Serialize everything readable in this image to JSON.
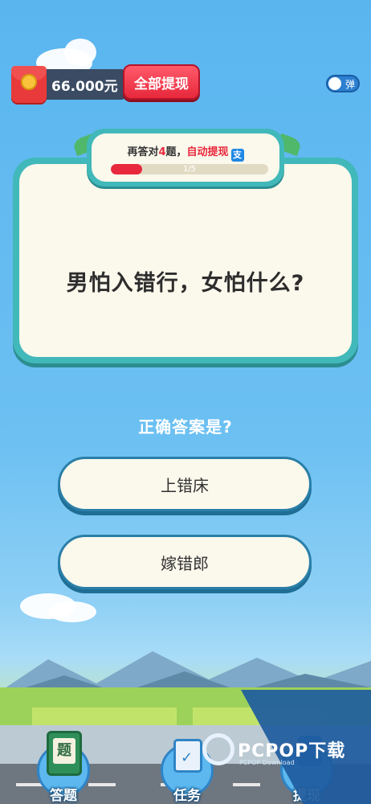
{
  "header": {
    "balance": "66.000元",
    "withdraw_all_label": "全部提现",
    "toggle_label": "弹"
  },
  "progress": {
    "prefix": "再答对",
    "remaining": "4",
    "suffix": "题，",
    "auto_label": "自动提现",
    "payment_icon": "alipay-icon",
    "counter": "1/5",
    "fraction": 0.2
  },
  "question": {
    "text": "男怕入错行，女怕什么?"
  },
  "answers": {
    "prompt": "正确答案是?",
    "options": [
      "上错床",
      "嫁错郎"
    ]
  },
  "bottom_nav": {
    "items": [
      {
        "label": "答题",
        "icon_text": "题",
        "icon": "book-icon"
      },
      {
        "label": "任务",
        "icon": "clipboard-check-icon"
      },
      {
        "label": "提现",
        "icon": "withdraw-icon"
      }
    ]
  },
  "watermark": {
    "text": "PCPOP下载",
    "sub": "PCPOP Download"
  },
  "colors": {
    "sky": "#5ab5ef",
    "card_border": "#41b8b9",
    "accent_red": "#e8283c",
    "card_bg": "#fbf8ec"
  }
}
